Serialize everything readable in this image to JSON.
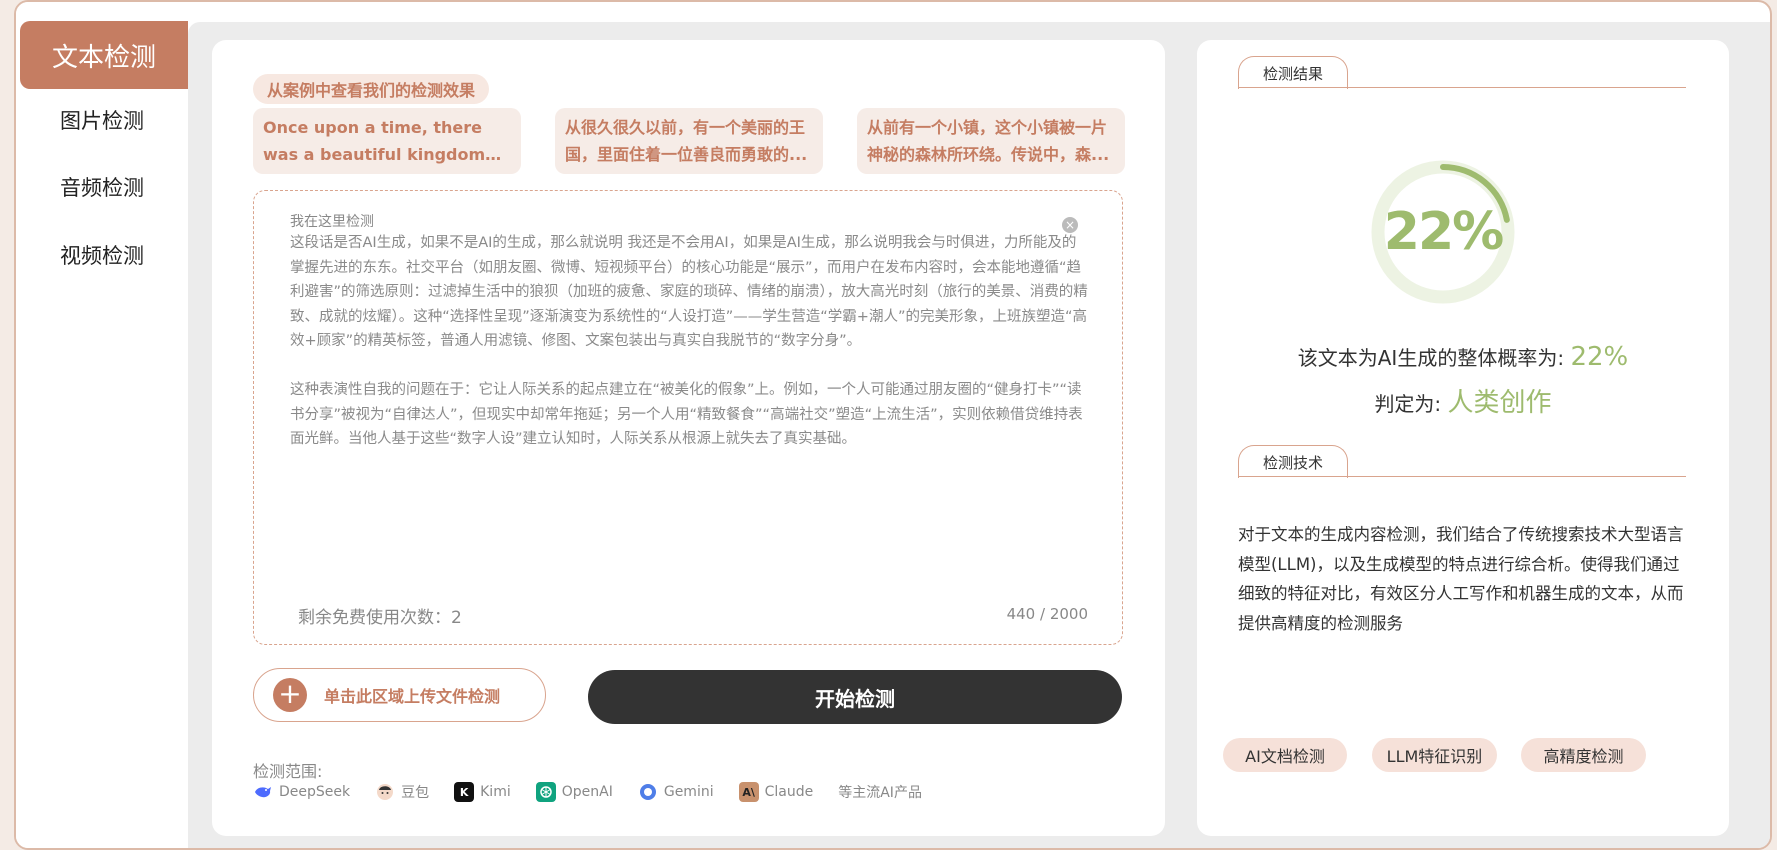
{
  "sidebar": {
    "items": [
      {
        "label": "文本检测",
        "active": true
      },
      {
        "label": "图片检测",
        "active": false
      },
      {
        "label": "音频检测",
        "active": false
      },
      {
        "label": "视频检测",
        "active": false
      }
    ]
  },
  "examples": {
    "tag": "从案例中查看我们的检测效果",
    "cards": [
      "Once upon a time, there was a beautiful kingdom where a...",
      "从很久很久以前，有一个美丽的王国，里面住着一位善良而勇敢的...",
      "从前有一个小镇，这个小镇被一片神秘的森林所环绕。传说中，森..."
    ]
  },
  "input": {
    "placeholder": "我在这里检测",
    "paragraphs": [
      "这段话是否AI生成，如果不是AI的生成，那么就说明 我还是不会用AI，如果是AI生成，那么说明我会与时俱进，力所能及的掌握先进的东东。社交平台（如朋友圈、微博、短视频平台）的核心功能是“展示”，而用户在发布内容时，会本能地遵循“趋利避害”的筛选原则：过滤掉生活中的狼狈（加班的疲惫、家庭的琐碎、情绪的崩溃），放大高光时刻（旅行的美景、消费的精致、成就的炫耀）。这种“选择性呈现”逐渐演变为系统性的“人设打造”——学生营造“学霸+潮人”的完美形象，上班族塑造“高效+顾家”的精英标签，普通人用滤镜、修图、文案包装出与真实自我脱节的“数字分身”。",
      "这种表演性自我的问题在于：它让人际关系的起点建立在“被美化的假象”上。例如，一个人可能通过朋友圈的“健身打卡”“读书分享”被视为“自律达人”，但现实中却常年拖延；另一个人用“精致餐食”“高端社交”塑造“上流生活”，实则依赖借贷维持表面光鲜。当他人基于这些“数字人设”建立认知时，人际关系从根源上就失去了真实基础。"
    ],
    "remaining_label": "剩余免费使用次数：",
    "remaining_count": "2",
    "counter": "440 / 2000"
  },
  "actions": {
    "upload_label": "单击此区域上传文件检测",
    "start_label": "开始检测"
  },
  "scope": {
    "label": "检测范围:",
    "models": [
      {
        "name": "DeepSeek",
        "icon": "deepseek-logo",
        "color": "#4d6bfe"
      },
      {
        "name": "豆包",
        "icon": "doubao-logo",
        "color": "#f0c8b4"
      },
      {
        "name": "Kimi",
        "icon": "kimi-logo",
        "color": "#111111"
      },
      {
        "name": "OpenAI",
        "icon": "openai-logo",
        "color": "#10a37f"
      },
      {
        "name": "Gemini",
        "icon": "gemini-logo",
        "color": "#4f7ee8"
      },
      {
        "name": "Claude",
        "icon": "claude-logo",
        "color": "#c8916d"
      }
    ],
    "suffix": "等主流AI产品"
  },
  "result": {
    "tag": "检测结果",
    "percent_text": "22%",
    "percent_value": 22,
    "prob_label": "该文本为AI生成的整体概率为:",
    "prob_value": "22%",
    "judge_label": "判定为:",
    "judge_value": "人类创作",
    "accent_color": "#9ebb6e"
  },
  "technology": {
    "tag": "检测技术",
    "description": "对于文本的生成内容检测，我们结合了传统搜索技术大型语言模型(LLM)，以及生成模型的特点进行综合析。使得我们通过细致的特征对比，有效区分人工写作和机器生成的文本，从而提供高精度的检测服务",
    "chips": [
      "AI文档检测",
      "LLM特征识别",
      "高精度检测"
    ]
  }
}
